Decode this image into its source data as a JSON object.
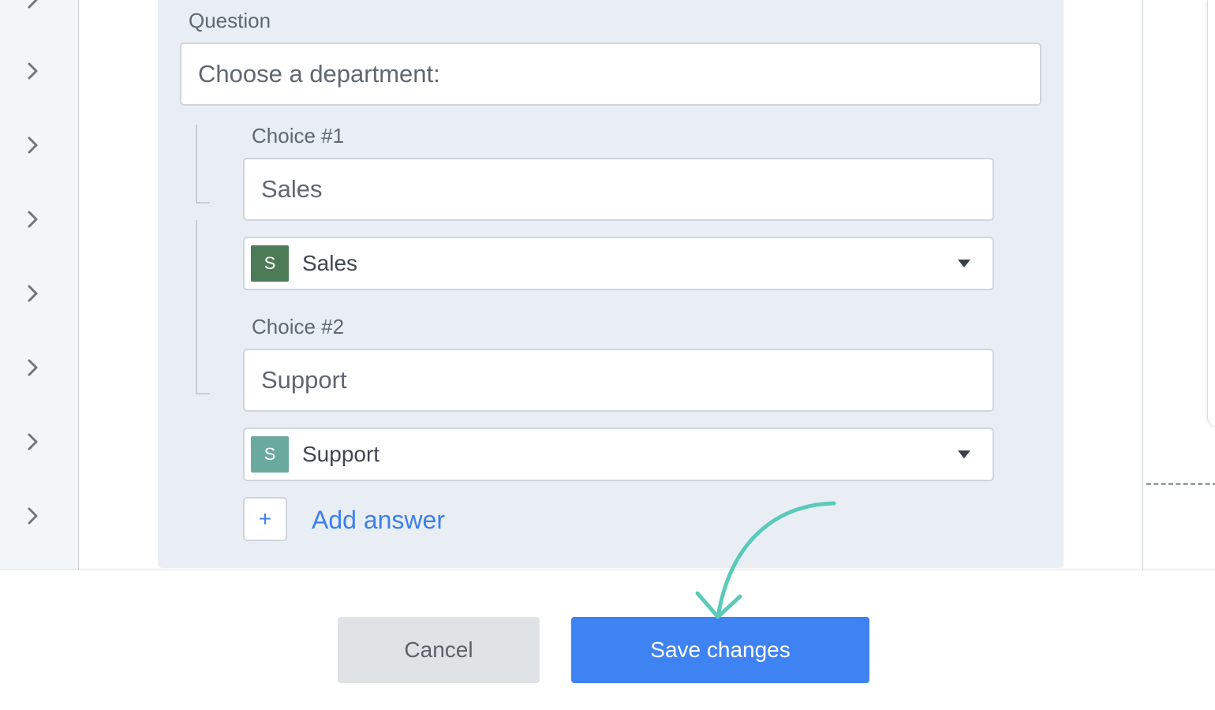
{
  "form": {
    "question_label": "Question",
    "question_value": "Choose a department:",
    "choices": [
      {
        "label": "Choice #1",
        "value": "Sales",
        "department": {
          "initial": "S",
          "name": "Sales",
          "color": "#4e7b57"
        }
      },
      {
        "label": "Choice #2",
        "value": "Support",
        "department": {
          "initial": "S",
          "name": "Support",
          "color": "#6aa99e"
        }
      }
    ],
    "add_icon": "+",
    "add_answer_label": "Add answer"
  },
  "footer": {
    "cancel_label": "Cancel",
    "save_label": "Save changes"
  },
  "colors": {
    "accent": "#3f82f1",
    "annotation_arrow": "#5ccab9"
  }
}
